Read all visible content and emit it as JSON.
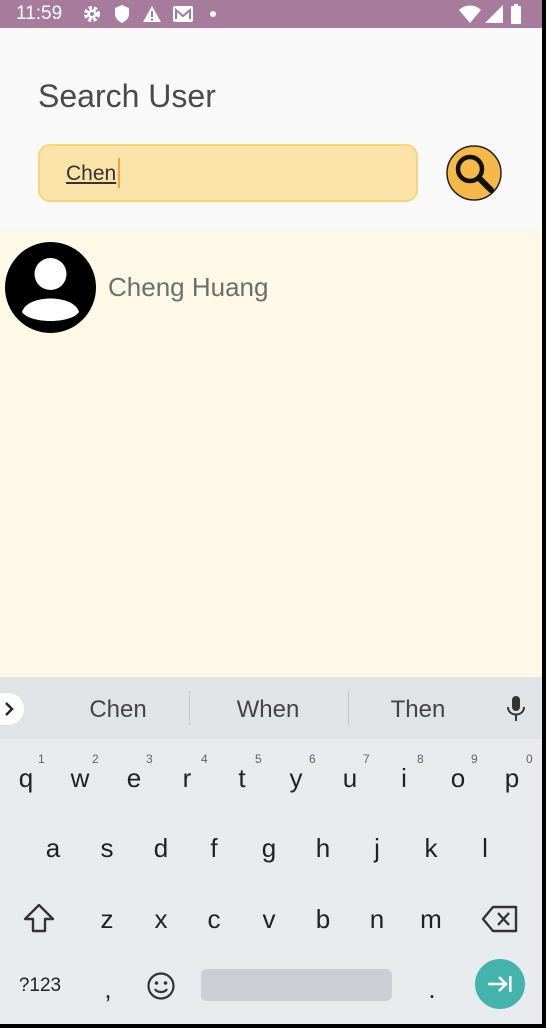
{
  "status_bar": {
    "time": "11:59",
    "left_icons": [
      "gear-icon",
      "shield-icon",
      "warning-icon",
      "mail-icon",
      "dot-icon"
    ],
    "right_icons": [
      "wifi-icon",
      "signal-icon",
      "battery-icon"
    ]
  },
  "header": {
    "title": "Search User",
    "search": {
      "value": "Chen"
    },
    "search_button_icon": "magnifier-icon"
  },
  "results": [
    {
      "name": "Cheng Huang",
      "avatar_icon": "person-avatar-icon"
    }
  ],
  "keyboard": {
    "suggestions": [
      "Chen",
      "When",
      "Then"
    ],
    "row1": [
      "q",
      "w",
      "e",
      "r",
      "t",
      "y",
      "u",
      "i",
      "o",
      "p"
    ],
    "row1_hints": [
      "1",
      "2",
      "3",
      "4",
      "5",
      "6",
      "7",
      "8",
      "9",
      "0"
    ],
    "row2": [
      "a",
      "s",
      "d",
      "f",
      "g",
      "h",
      "j",
      "k",
      "l"
    ],
    "row3": [
      "z",
      "x",
      "c",
      "v",
      "b",
      "n",
      "m"
    ],
    "bottom": {
      "symbols": "?123",
      "comma": ",",
      "period": "."
    }
  },
  "colors": {
    "status_bar": "#a77b9c",
    "content_bg": "#fdf9e6",
    "search_fill": "#fae3a9",
    "search_button": "#f7b84a",
    "enter_key": "#43b3ac"
  }
}
